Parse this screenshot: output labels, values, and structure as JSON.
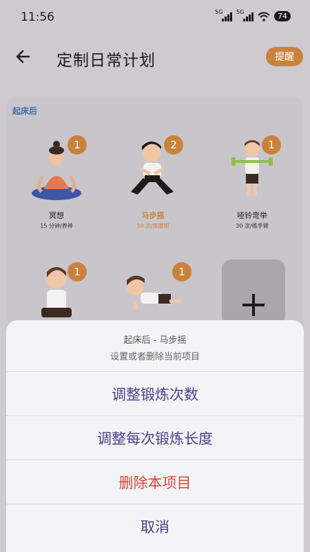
{
  "status_bar": {
    "time": "11:56",
    "signal_label_1": "5G",
    "signal_label_2": "5G",
    "battery": "74"
  },
  "header": {
    "title": "定制日常计划",
    "remind_label": "提醒"
  },
  "section": {
    "label": "起床后"
  },
  "exercises": [
    {
      "name": "冥想",
      "detail": "15 分钟/养神",
      "count": "1",
      "icon": "meditation-figure"
    },
    {
      "name": "马步摇",
      "detail": "30 次/练腰眼",
      "count": "2",
      "icon": "horse-stance-figure",
      "selected": true
    },
    {
      "name": "哑铃弯举",
      "detail": "30 次/练手臂",
      "count": "1",
      "icon": "dumbbell-curl-figure"
    },
    {
      "name": "",
      "detail": "",
      "count": "1",
      "icon": "squat-figure"
    },
    {
      "name": "",
      "detail": "",
      "count": "1",
      "icon": "plank-figure"
    }
  ],
  "sheet": {
    "title": "起床后 - 马步摇",
    "subtitle": "设置或者删除当前项目",
    "options": [
      {
        "label": "调整锻炼次数",
        "color": "#4b3f8f"
      },
      {
        "label": "调整每次锻炼长度",
        "color": "#4b3f8f"
      },
      {
        "label": "删除本项目",
        "color": "#d9473d"
      },
      {
        "label": "取消",
        "color": "#4b3f8f"
      }
    ]
  },
  "colors": {
    "accent": "#c9823c",
    "section_label": "#4a6ca8",
    "sheet_option": "#4b3f8f",
    "danger": "#d9473d"
  }
}
